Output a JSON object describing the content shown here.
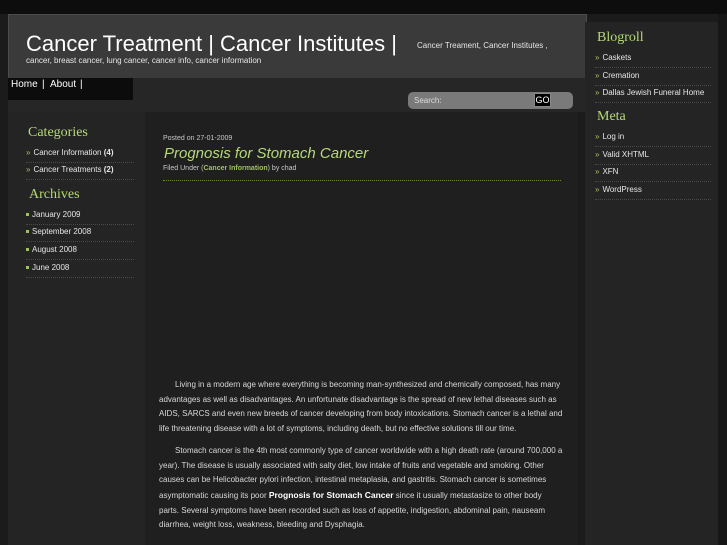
{
  "header": {
    "title": "Cancer Treatment | Cancer Institutes |",
    "description": "Cancer Treament, Cancer Institutes ,",
    "tags": "cancer, breast cancer, lung cancer, cancer info, cancer information"
  },
  "nav": {
    "items": [
      "Home",
      "About"
    ],
    "separator": "|"
  },
  "search": {
    "placeholder": "Search:",
    "button": "GO"
  },
  "sidebar": {
    "categories_title": "Categories",
    "categories": [
      {
        "name": "Cancer Information",
        "count": "(4)"
      },
      {
        "name": "Cancer Treatments",
        "count": "(2)"
      }
    ],
    "archives_title": "Archives",
    "archives": [
      "January 2009",
      "September 2008",
      "August 2008",
      "June 2008"
    ]
  },
  "post": {
    "date": "Posted on 27-01-2009",
    "title": "Prognosis for Stomach Cancer",
    "filed_prefix": "Filed Under (",
    "category": "Cancer Information",
    "filed_suffix": ") by chad",
    "p1": "Living in a modern age where everything is becoming man-synthesized and chemically composed, has many advantages as well as disadvantages. An unfortunate disadvantage is the spread of new lethal diseases such as AIDS, SARCS and even new breeds of cancer developing from body intoxications. Stomach cancer is a lethal and life threatening disease with a lot of symptoms, including death, but no effective solutions till our time.",
    "p2_a": "Stomach cancer is the 4th most commonly type of cancer worldwide with a high death rate (around 700,000 a year). The disease is usually associated with salty diet, low intake of fruits and vegetable and smoking. Other causes can be Helicobacter pylori infection, intestinal metaplasia, and gastritis. Stomach cancer is sometimes asymptomatic causing its poor ",
    "p2_bold": "Prognosis for Stomach Cancer",
    "p2_b": " since it usually metastasize to other body parts. Several symptoms have been recorded such as loss of appetite, indigestion, abdominal pain, nauseam diarrhea, weight loss, weakness, bleeding and Dysphagia."
  },
  "blogroll": {
    "title": "Blogroll",
    "items": [
      "Caskets",
      "Cremation",
      "Dallas Jewish Funeral Home"
    ]
  },
  "meta": {
    "title": "Meta",
    "items": [
      "Log in",
      "Valid XHTML",
      "XFN",
      "WordPress"
    ]
  },
  "colors": {
    "accent_green": "#b6d97a",
    "background": "#1b1b1b"
  }
}
